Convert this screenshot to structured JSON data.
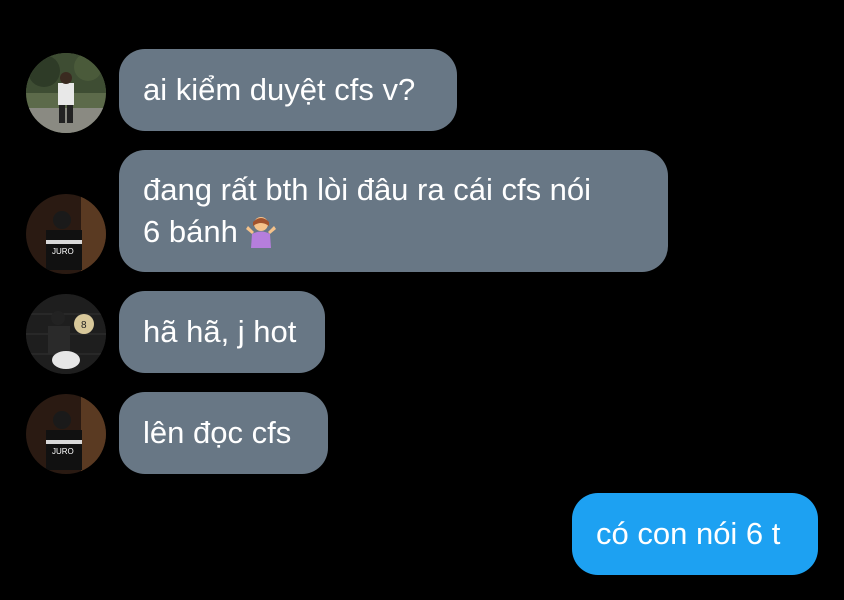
{
  "messages": [
    {
      "sender": "user-a",
      "text": "ai kiểm duyệt cfs v?"
    },
    {
      "sender": "user-b",
      "line1": "đang rất bth lòi đâu ra cái cfs nói",
      "line2": "6 bánh",
      "emoji": "person-shrugging-emoji"
    },
    {
      "sender": "user-c",
      "text": "hã hã, j hot"
    },
    {
      "sender": "user-b",
      "text": "lên đọc cfs"
    },
    {
      "sender": "me",
      "text": "có con nói 6 t"
    }
  ],
  "avatars": {
    "user_b_shirt_text": "JURO",
    "user_c_sign_text": "8"
  },
  "colors": {
    "background": "#000000",
    "incoming_bubble": "#687785",
    "outgoing_bubble": "#1da1f2",
    "text": "#ffffff"
  }
}
